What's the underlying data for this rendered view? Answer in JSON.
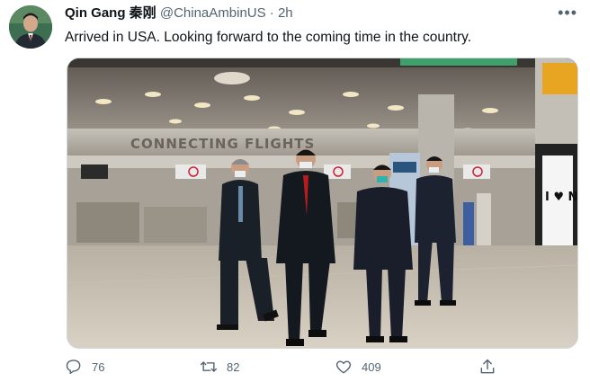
{
  "tweet": {
    "author_name": "Qin Gang 秦刚",
    "handle": "@ChinaAmbinUS",
    "separator": "·",
    "time": "2h",
    "text": "Arrived in USA. Looking forward to the coming time in the country.",
    "photo": {
      "sign_text": "CONNECTING FLIGHTS",
      "poster_text": "I ♥ NY"
    }
  },
  "actions": {
    "reply_count": "76",
    "retweet_count": "82",
    "like_count": "409"
  },
  "icons": {
    "more": "more-icon",
    "reply": "reply-icon",
    "retweet": "retweet-icon",
    "like": "like-icon",
    "share": "share-icon"
  }
}
